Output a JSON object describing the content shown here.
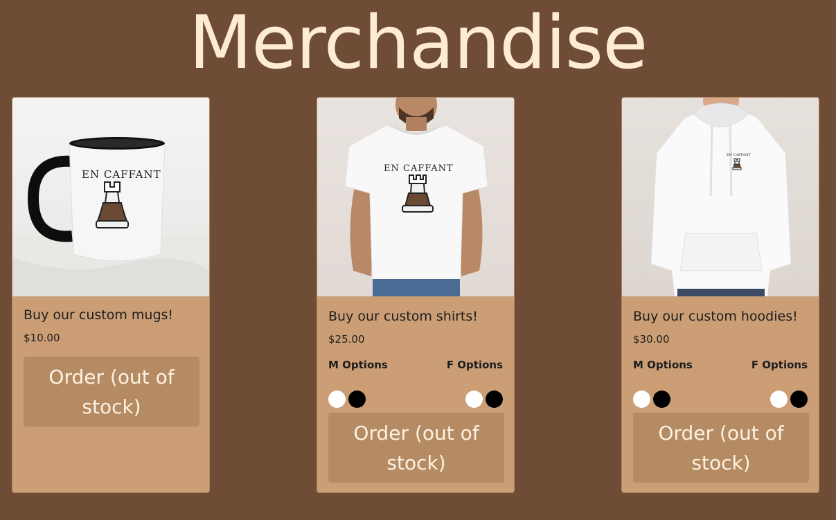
{
  "page": {
    "title": "Merchandise"
  },
  "colors": {
    "background": "#6e4c35",
    "title": "#fdebd3",
    "card": "#cb9e76",
    "button": "#b58b63",
    "button_text": "#fdf2e2"
  },
  "products": [
    {
      "title": "Buy our custom mugs!",
      "price": "$10.00",
      "image_label": "EN CAFFANT",
      "order_label": "Order (out of stock)"
    },
    {
      "title": "Buy our custom shirts!",
      "price": "$25.00",
      "image_label": "EN CAFFANT",
      "m_options_label": "M Options",
      "f_options_label": "F Options",
      "colors": [
        "white",
        "black"
      ],
      "order_label": "Order (out of stock)"
    },
    {
      "title": "Buy our custom hoodies!",
      "price": "$30.00",
      "image_label": "EN CAFFANT",
      "m_options_label": "M Options",
      "f_options_label": "F Options",
      "colors": [
        "white",
        "black"
      ],
      "order_label": "Order (out of stock)"
    }
  ]
}
